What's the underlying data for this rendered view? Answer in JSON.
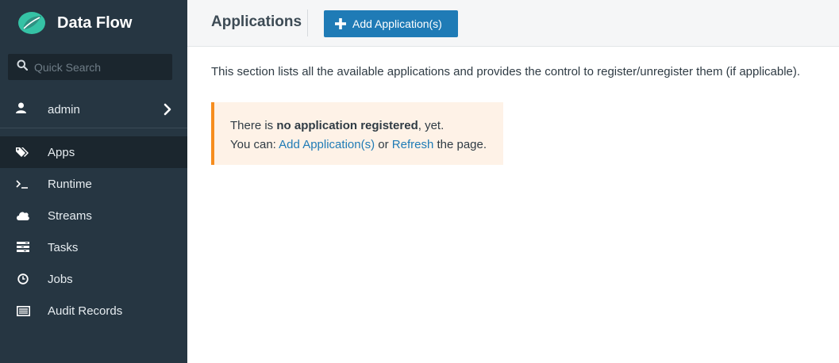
{
  "app": {
    "title": "Data Flow"
  },
  "search": {
    "placeholder": "Quick Search"
  },
  "user": {
    "name": "admin"
  },
  "nav": {
    "items": [
      {
        "label": "Apps",
        "icon": "tags-icon",
        "active": true
      },
      {
        "label": "Runtime",
        "icon": "terminal-icon"
      },
      {
        "label": "Streams",
        "icon": "cloud-icon"
      },
      {
        "label": "Tasks",
        "icon": "tasks-icon"
      },
      {
        "label": "Jobs",
        "icon": "clock-icon"
      },
      {
        "label": "Audit Records",
        "icon": "list-icon"
      }
    ]
  },
  "header": {
    "title": "Applications",
    "add_button_label": "Add Application(s)"
  },
  "main": {
    "description": "This section lists all the available applications and provides the control to register/unregister them (if applicable).",
    "alert": {
      "line1_prefix": "There is ",
      "line1_bold": "no application registered",
      "line1_suffix": ", yet.",
      "line2_prefix": "You can: ",
      "add_link": "Add Application(s)",
      "or_text": " or ",
      "refresh_link": "Refresh",
      "line2_suffix": " the page."
    }
  },
  "colors": {
    "sidebar": "#263642",
    "primary": "#1f7bb6",
    "warning": "#f68d1e",
    "brand": "#35c2a5"
  }
}
